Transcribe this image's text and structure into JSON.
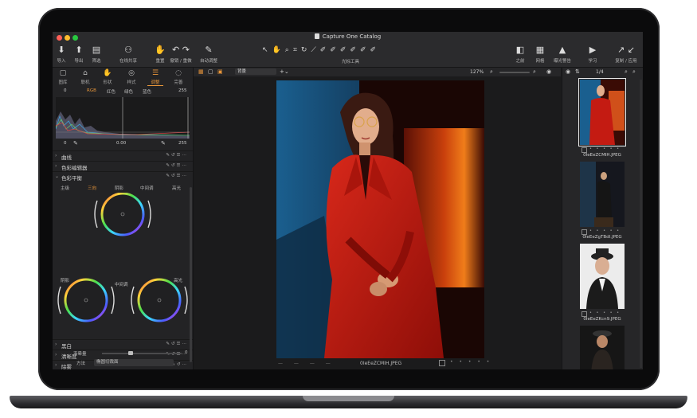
{
  "window": {
    "title": "Capture One Catalog"
  },
  "toolbar": {
    "left": [
      {
        "icon": "import-icon",
        "label": "导入"
      },
      {
        "icon": "export-icon",
        "label": "导出"
      },
      {
        "icon": "filter-icon",
        "label": "筛选"
      },
      {
        "icon": "live-share-icon",
        "label": "在线共享"
      },
      {
        "icon": "reset-icon",
        "label": "重置"
      },
      {
        "icon": "undo-redo-icon",
        "label": "撤销 / 重做"
      },
      {
        "icon": "auto-adjust-icon",
        "label": "自动调整"
      }
    ],
    "cursor_tools_label": "光标工具",
    "right": [
      {
        "icon": "compare-icon",
        "label": "之前"
      },
      {
        "icon": "grid-icon",
        "label": "网格"
      },
      {
        "icon": "exposure-warning-icon",
        "label": "曝光警告"
      },
      {
        "icon": "learn-icon",
        "label": "学习"
      },
      {
        "icon": "copy-apply-icon",
        "label": "复制 / 应用"
      }
    ]
  },
  "tool_tabs": [
    {
      "icon": "folder-icon",
      "label": "图库"
    },
    {
      "icon": "camera-icon",
      "label": "联机"
    },
    {
      "icon": "shape-icon",
      "label": "形状"
    },
    {
      "icon": "style-icon",
      "label": "样式"
    },
    {
      "icon": "adjust-icon",
      "label": "调整",
      "active": true
    },
    {
      "icon": "refine-icon",
      "label": "完善"
    }
  ],
  "histogram": {
    "tabs": [
      "RGB",
      "红色",
      "绿色",
      "蓝色"
    ],
    "low_in": "0",
    "high_in": "255",
    "low_out": "0",
    "mid": "0.00",
    "high_out": "255"
  },
  "tools_top": [
    {
      "name": "曲线",
      "open": false
    },
    {
      "name": "色彩编辑器",
      "open": false
    },
    {
      "name": "色彩平衡",
      "open": true
    }
  ],
  "color_balance": {
    "tabs": [
      "主级",
      "三向",
      "阴影",
      "中间调",
      "高光"
    ],
    "active_tab": "三向",
    "shadows_label": "阴影",
    "midtones_label": "中间调",
    "highlights_label": "高光"
  },
  "tools_bottom": [
    {
      "name": "黑白",
      "open": false
    },
    {
      "name": "清晰度",
      "open": false
    },
    {
      "name": "除雾",
      "open": false
    },
    {
      "name": "渐晕",
      "open": true
    }
  ],
  "vignette": {
    "amount_label": "渐晕量",
    "amount_value": "0",
    "method_label": "方法",
    "method_value": "椭圆切裁面"
  },
  "viewer": {
    "background_label": "背景",
    "zoom": "127%",
    "page": "1/4",
    "filename": "0IeEeZCMIH.JPEG"
  },
  "filmstrip": [
    {
      "name": "0IeEeZCMIH.JPEG",
      "selected": true
    },
    {
      "name": "0IeEeZgTBdI.JPEG",
      "selected": false
    },
    {
      "name": "0IeEeZKcn9.JPEG",
      "selected": false
    },
    {
      "name": "",
      "selected": false
    }
  ],
  "colors": {
    "accent": "#e8963a",
    "panel": "#232325",
    "red_suit": "#c41b12",
    "blue_bg": "#1f5a86"
  }
}
